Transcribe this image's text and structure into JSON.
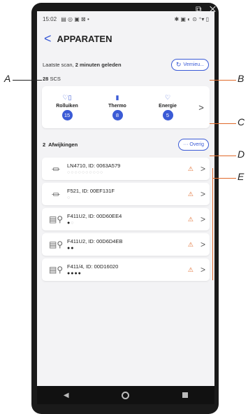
{
  "statusbar": {
    "time": "15:02",
    "left_icons": "▤ ◎ ▣ ⊠ •",
    "right_icons": "✱ ▣ ◐ ⊙ ⁺▾ ▯"
  },
  "corner_icons": "⧉ ✕",
  "header": {
    "back": "<",
    "title": "APPARATEN"
  },
  "scan": {
    "prefix": "Laatste scan, ",
    "bold": "2 minuten geleden",
    "refresh_label": "Vernieu..."
  },
  "scs": {
    "count": "28",
    "label": "SCS"
  },
  "categories": [
    {
      "label": "Rolluiken",
      "count": "15",
      "icon": "♡▯"
    },
    {
      "label": "Thermo",
      "count": "8",
      "icon": "▮"
    },
    {
      "label": "Energie",
      "count": "5",
      "icon": "♡"
    }
  ],
  "categories_more": ">",
  "deviations": {
    "count": "2",
    "label": "Afwijkingen",
    "other_label": "··· Overig"
  },
  "devices": [
    {
      "name": "LN4710, ID: 0063A579",
      "icon": "⏛",
      "dots_on": "",
      "dots_off": "○○○○○○○○○○"
    },
    {
      "name": "F521, ID: 00EF131F",
      "icon": "⏛",
      "dots_on": "",
      "dots_off": "○"
    },
    {
      "name": "F411U2, ID: 00D60EE4",
      "icon": "▤⚲",
      "dots_on": "●",
      "dots_off": "○"
    },
    {
      "name": "F411U2, ID: 00D6D4EB",
      "icon": "▤⚲",
      "dots_on": "●●",
      "dots_off": ""
    },
    {
      "name": "F411/4, ID: 00D16020",
      "icon": "▤⚲",
      "dots_on": "●●●●",
      "dots_off": ""
    }
  ],
  "warning_icon": "⚠",
  "chevron": ">",
  "callouts": {
    "A": "A",
    "B": "B",
    "C": "C",
    "D": "D",
    "E": "E"
  },
  "navbar": {
    "back": "◀"
  },
  "colors": {
    "accent": "#3b5bd6",
    "warning": "#e06a2b",
    "callout_line": "#e06a2b"
  }
}
